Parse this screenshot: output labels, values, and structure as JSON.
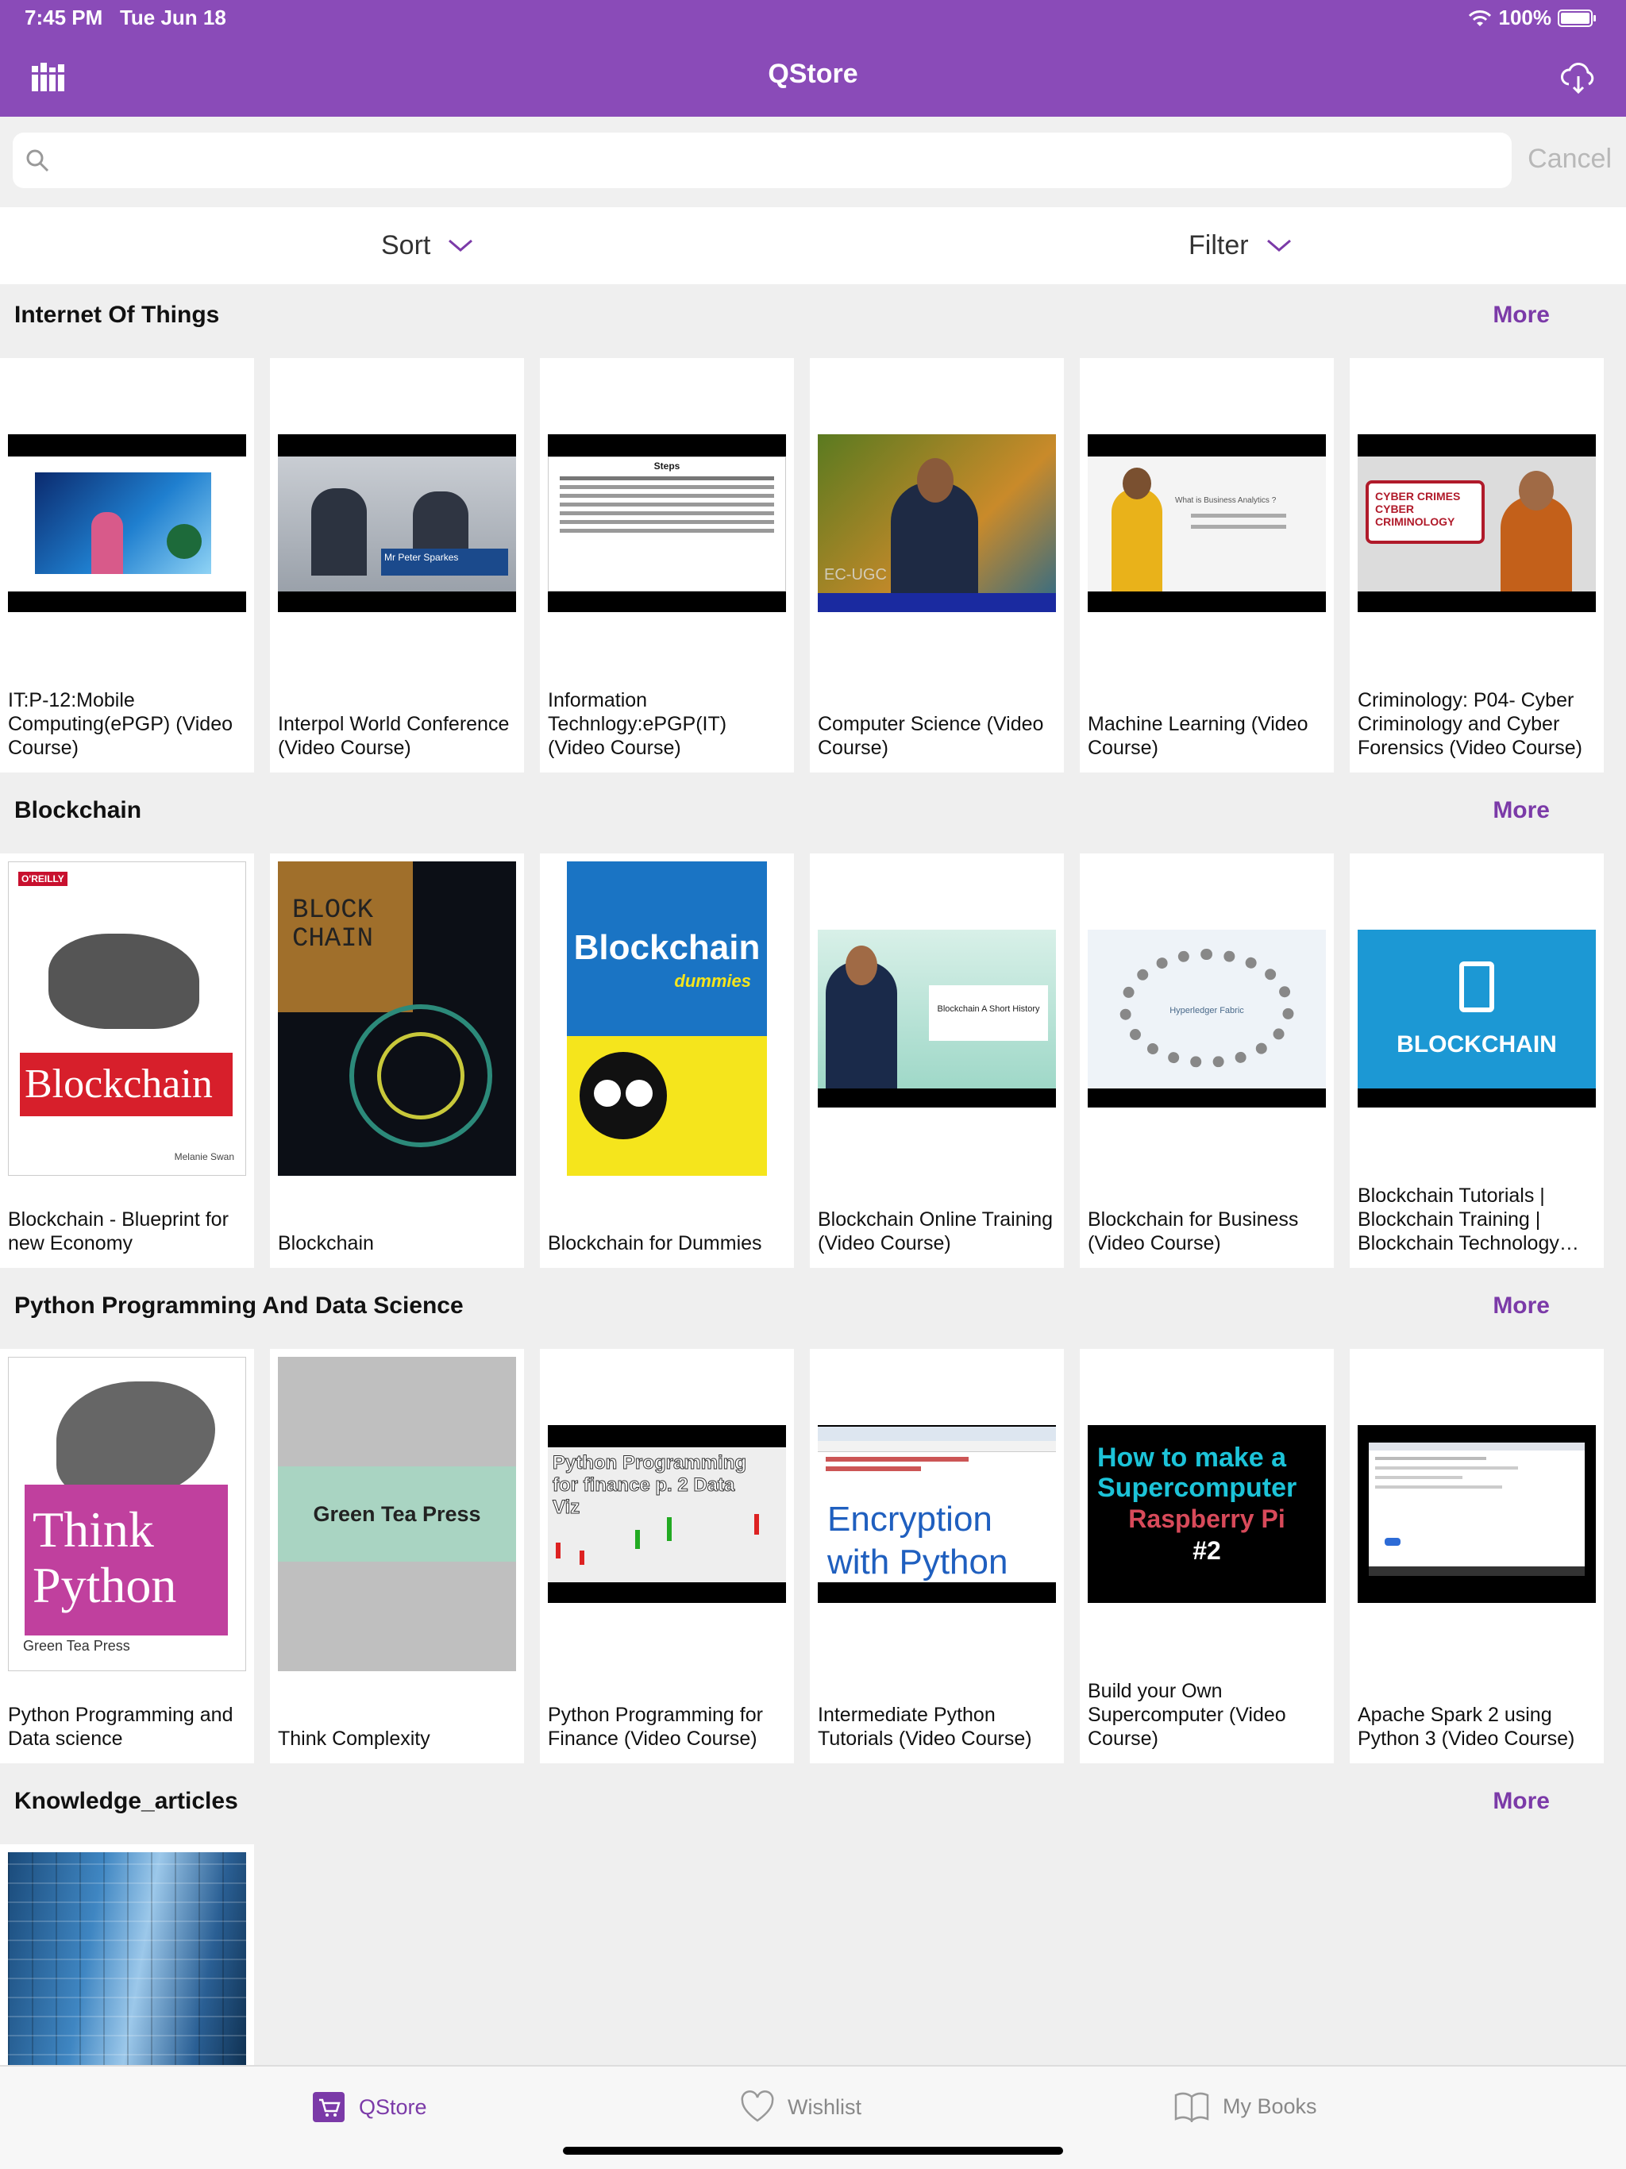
{
  "status": {
    "time": "7:45 PM",
    "date": "Tue Jun 18",
    "battery": "100%"
  },
  "app": {
    "title": "QStore"
  },
  "search": {
    "placeholder": "",
    "cancel_label": "Cancel"
  },
  "controls": {
    "sort_label": "Sort",
    "filter_label": "Filter"
  },
  "more_label": "More",
  "sections": [
    {
      "title": "Internet Of Things",
      "items": [
        {
          "title": "IT:P-12:Mobile Computing(ePGP) (Video Course)",
          "thumb": "video-iot"
        },
        {
          "title": "Interpol World Conference (Video Course)",
          "thumb": "video-interpol",
          "caption": "Mr Peter Sparkes"
        },
        {
          "title": "Information Technlogy:ePGP(IT) (Video Course)",
          "thumb": "video-slide",
          "slide_title": "Steps"
        },
        {
          "title": "Computer Science (Video Course)",
          "thumb": "video-cec",
          "caption": "EC-UGC"
        },
        {
          "title": "Machine Learning (Video Course)",
          "thumb": "video-ml",
          "caption": "What is Business Analytics ?"
        },
        {
          "title": "Criminology: P04- Cyber Criminology and Cyber Forensics (Video Course)",
          "thumb": "video-cyber",
          "caption": "CYBER CRIMES CYBER CRIMINOLOGY"
        }
      ]
    },
    {
      "title": "Blockchain",
      "items": [
        {
          "title": "Blockchain - Blueprint for new Economy",
          "thumb": "book-oreilly",
          "publisher": "O'REILLY",
          "cover_title": "Blockchain",
          "author": "Melanie Swan"
        },
        {
          "title": "Blockchain",
          "thumb": "book-fundamentals",
          "cover_title": "BLOCK CHAIN"
        },
        {
          "title": "Blockchain for Dummies",
          "thumb": "book-dummies",
          "cover_title": "Blockchain",
          "cover_sub": "dummies"
        },
        {
          "title": "Blockchain Online Training (Video Course)",
          "thumb": "video-tutorials",
          "caption": "Blockchain A Short History"
        },
        {
          "title": "Blockchain for Business (Video Course)",
          "thumb": "video-fabric",
          "caption": "Hyperledger Fabric"
        },
        {
          "title": "Blockchain Tutorials | Blockchain Training | Blockchain Technology…",
          "thumb": "video-blockchain",
          "caption": "BLOCKCHAIN"
        }
      ]
    },
    {
      "title": "Python Programming And Data Science",
      "items": [
        {
          "title": "Python Programming and Data science",
          "thumb": "book-thinkpython",
          "cover_title": "Think Python",
          "publisher": "Green Tea Press"
        },
        {
          "title": "Think Complexity",
          "thumb": "book-greentea",
          "cover_title": "Green Tea Press"
        },
        {
          "title": "Python Programming for Finance (Video Course)",
          "thumb": "video-finance",
          "caption": "Python Programming for finance p. 2 Data Viz"
        },
        {
          "title": "Intermediate Python Tutorials (Video Course)",
          "thumb": "video-encryption",
          "caption": "Encryption with Python"
        },
        {
          "title": "Build your Own Supercomputer (Video Course)",
          "thumb": "video-supercomputer",
          "caption": "How to make a Supercomputer",
          "caption2": "Raspberry Pi",
          "caption3": "#2"
        },
        {
          "title": "Apache Spark 2 using Python 3 (Video Course)",
          "thumb": "video-spark"
        }
      ]
    },
    {
      "title": "Knowledge_articles",
      "items": [
        {
          "title": "",
          "thumb": "image-building"
        }
      ]
    }
  ],
  "tabs": [
    {
      "label": "QStore",
      "icon": "cart-icon",
      "active": true
    },
    {
      "label": "Wishlist",
      "icon": "heart-icon",
      "active": false
    },
    {
      "label": "My Books",
      "icon": "book-icon",
      "active": false
    }
  ],
  "colors": {
    "brand": "#8a4bb8",
    "accent": "#7b3aa8"
  }
}
